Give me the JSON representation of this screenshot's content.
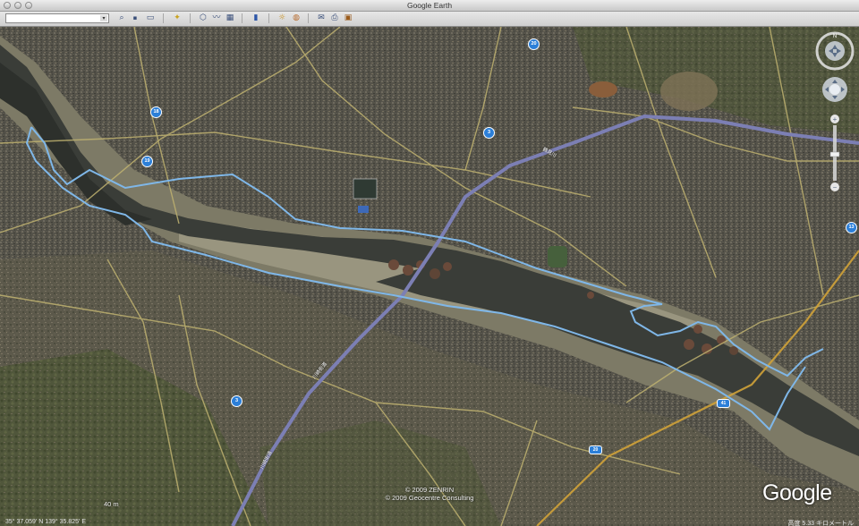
{
  "window": {
    "title": "Google Earth"
  },
  "toolbar": {
    "search_value": "",
    "buttons": [
      {
        "name": "search-icon",
        "glyph": "🔍"
      },
      {
        "name": "sidebar-toggle-icon",
        "glyph": "▭"
      },
      {
        "name": "placemark-icon",
        "glyph": "✦"
      },
      {
        "name": "polygon-icon",
        "glyph": "⬡"
      },
      {
        "name": "path-icon",
        "glyph": "〰"
      },
      {
        "name": "overlay-icon",
        "glyph": "▦"
      },
      {
        "name": "record-tour-icon",
        "glyph": "▮"
      },
      {
        "name": "historical-imagery-icon",
        "glyph": "☼"
      },
      {
        "name": "sky-icon",
        "glyph": "◍"
      },
      {
        "name": "email-icon",
        "glyph": "✉"
      },
      {
        "name": "print-icon",
        "glyph": "⎙"
      },
      {
        "name": "save-image-icon",
        "glyph": "▣"
      }
    ]
  },
  "map": {
    "copyright_line1": "© 2009 ZENRIN",
    "copyright_line2": "© 2009 Geocentre Consulting",
    "elevation": "40 m",
    "logo": "Google",
    "status_coords": "35° 37.059' N   139° 35.825' E",
    "status_right": "高度   5.33 キロメートル",
    "road_labels": [
      "川崎街道",
      "川崎街道",
      "鶴見川"
    ],
    "route_badges": [
      "18",
      "19",
      "3",
      "20",
      "13",
      "3",
      "41",
      "20"
    ],
    "colors": {
      "river_water": "#3b3e3a",
      "riverbed": "#8e8a78",
      "outline_blue": "#7fb7e8",
      "highway": "#7c7fb4",
      "urban": "#4f4d45"
    }
  }
}
